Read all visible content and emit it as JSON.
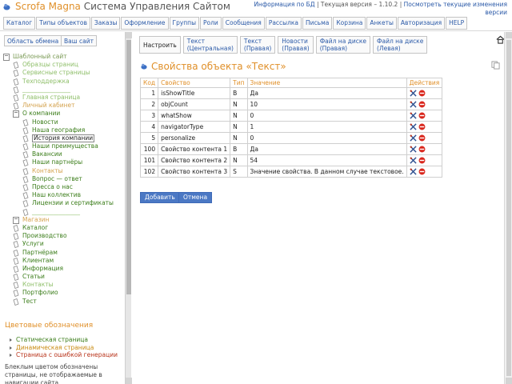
{
  "header": {
    "app_name": "Scrofa Magna",
    "app_subtitle": "Система Управления Сайтом",
    "db_info": "Информация по БД",
    "current_version": "Текущая версия – 1.10.2",
    "changes_link": "Посмотреть текущие изменения версии",
    "separator": "|"
  },
  "menu": [
    "Каталог",
    "Типы объектов",
    "Заказы",
    "Оформление",
    "Группы",
    "Роли",
    "Сообщения",
    "Рассылка",
    "Письма",
    "Корзина",
    "Анкеты",
    "Авторизация",
    "HELP"
  ],
  "sidebar": {
    "clipboard_label": "Область обмена",
    "your_site_label": "Ваш сайт",
    "tree": [
      {
        "label": "Шаблонный сайт",
        "style": "muted",
        "level": 0,
        "icon": "folder"
      },
      {
        "label": "Образцы страниц",
        "style": "light",
        "level": 1,
        "icon": "page"
      },
      {
        "label": "Сервисные страницы",
        "style": "light",
        "level": 1,
        "icon": "page"
      },
      {
        "label": "Техподдержка",
        "style": "light",
        "level": 1,
        "icon": "page"
      },
      {
        "label": "________________",
        "style": "light",
        "level": 1,
        "icon": "page"
      },
      {
        "label": "Главная страница",
        "style": "light",
        "level": 1,
        "icon": "page"
      },
      {
        "label": "Личный кабинет",
        "style": "faded",
        "level": 1,
        "icon": "page"
      },
      {
        "label": "О компании",
        "style": "green",
        "level": 1,
        "icon": "folder"
      },
      {
        "label": "Новости",
        "style": "green",
        "level": 2,
        "icon": "page"
      },
      {
        "label": "Наша география",
        "style": "green",
        "level": 2,
        "icon": "page"
      },
      {
        "label": "История компании",
        "style": "selected",
        "level": 2,
        "icon": "page"
      },
      {
        "label": "Наши преимущества",
        "style": "green",
        "level": 2,
        "icon": "page"
      },
      {
        "label": "Вакансии",
        "style": "green",
        "level": 2,
        "icon": "page"
      },
      {
        "label": "Наши партнёры",
        "style": "green",
        "level": 2,
        "icon": "page"
      },
      {
        "label": "Контакты",
        "style": "faded",
        "level": 2,
        "icon": "page"
      },
      {
        "label": "Вопрос — ответ",
        "style": "green",
        "level": 2,
        "icon": "page"
      },
      {
        "label": "Пресса о нас",
        "style": "green",
        "level": 2,
        "icon": "page"
      },
      {
        "label": "Наш коллектив",
        "style": "green",
        "level": 2,
        "icon": "page"
      },
      {
        "label": "Лицензии и сертификаты",
        "style": "green",
        "level": 2,
        "icon": "page"
      },
      {
        "label": "________________",
        "style": "light",
        "level": 2,
        "icon": "page"
      },
      {
        "label": "Магазин",
        "style": "faded",
        "level": 1,
        "icon": "folder"
      },
      {
        "label": "Каталог",
        "style": "green",
        "level": 1,
        "icon": "page"
      },
      {
        "label": "Производство",
        "style": "green",
        "level": 1,
        "icon": "page"
      },
      {
        "label": "Услуги",
        "style": "green",
        "level": 1,
        "icon": "page"
      },
      {
        "label": "Партнёрам",
        "style": "green",
        "level": 1,
        "icon": "page"
      },
      {
        "label": "Клиентам",
        "style": "green",
        "level": 1,
        "icon": "page"
      },
      {
        "label": "Информация",
        "style": "green",
        "level": 1,
        "icon": "page"
      },
      {
        "label": "Статьи",
        "style": "green",
        "level": 1,
        "icon": "page"
      },
      {
        "label": "Контакты",
        "style": "light",
        "level": 1,
        "icon": "page"
      },
      {
        "label": "Портфолио",
        "style": "green",
        "level": 1,
        "icon": "page"
      },
      {
        "label": "Тест",
        "style": "green",
        "level": 1,
        "icon": "page"
      }
    ],
    "legend_title": "Цветовые обозначения",
    "legend": [
      {
        "label": "Статическая страница",
        "color": "#3b7d1a"
      },
      {
        "label": "Динамическая страница",
        "color": "#c88a10"
      },
      {
        "label": "Страница с ошибкой генерации",
        "color": "#b8331a"
      }
    ],
    "legend_note": "Блеклым цветом обозначены страницы, не отображаемые в навигации сайта."
  },
  "tabs": [
    {
      "label": "Настроить",
      "sub": ""
    },
    {
      "label": "Текст",
      "sub": "(Центральная)"
    },
    {
      "label": "Текст",
      "sub": "(Правая)"
    },
    {
      "label": "Новости",
      "sub": "(Правая)"
    },
    {
      "label": "Файл на диске",
      "sub": "(Правая)"
    },
    {
      "label": "Файл на диске",
      "sub": "(Левая)"
    }
  ],
  "content": {
    "title": "Свойства объекта «Текст»",
    "columns": [
      "Код",
      "Свойство",
      "Тип",
      "Значение",
      "Действия"
    ],
    "rows": [
      {
        "code": "1",
        "name": "isShowTitle",
        "type": "B",
        "value": "Да"
      },
      {
        "code": "2",
        "name": "objCount",
        "type": "N",
        "value": "10"
      },
      {
        "code": "3",
        "name": "whatShow",
        "type": "N",
        "value": "0"
      },
      {
        "code": "4",
        "name": "navigatorType",
        "type": "N",
        "value": "1"
      },
      {
        "code": "5",
        "name": "personalize",
        "type": "N",
        "value": "0"
      },
      {
        "code": "100",
        "name": "Свойство контента 1",
        "type": "B",
        "value": "Да"
      },
      {
        "code": "101",
        "name": "Свойство контента 2",
        "type": "N",
        "value": "54"
      },
      {
        "code": "102",
        "name": "Свойство контента 3",
        "type": "S",
        "value": "Значение свойства. В данном случае текстовое."
      }
    ],
    "add_label": "Добавить",
    "cancel_label": "Отмена"
  },
  "colors": {
    "accent": "#e0902a",
    "link": "#2b5aa8",
    "green": "#3b7d1a",
    "light": "#8fbf6a",
    "faded": "#d4a24e",
    "button": "#4b78c4"
  }
}
